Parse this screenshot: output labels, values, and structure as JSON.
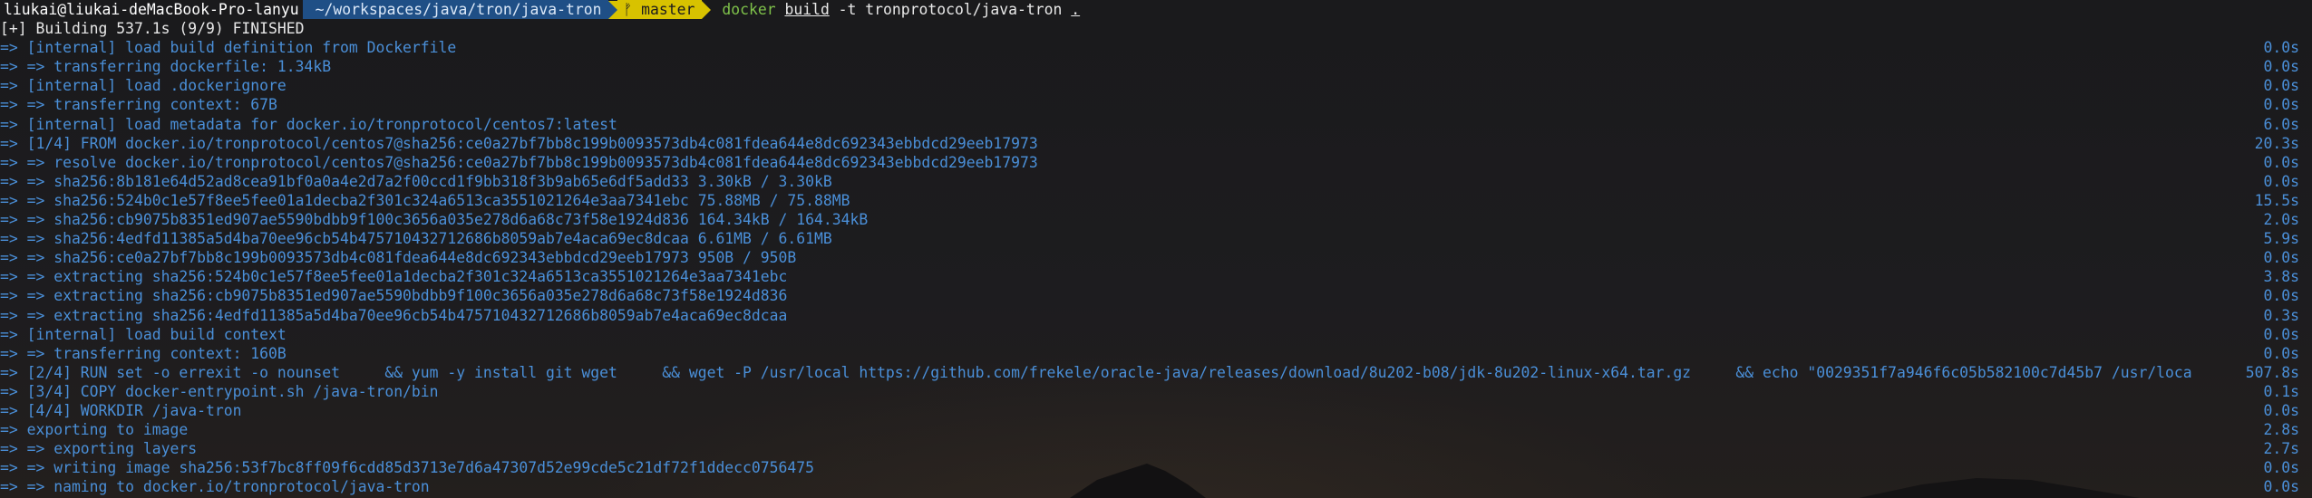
{
  "prompt": {
    "user_host": "liukai@liukai-deMacBook-Pro-lanyu",
    "path": "~/workspaces/java/tron/java-tron",
    "git_symbol": "ᚠ",
    "branch": "master",
    "cmd_docker": "docker",
    "cmd_build": "build",
    "cmd_args": " -t tronprotocol/java-tron ",
    "cmd_dot": "."
  },
  "header": "[+] Building 537.1s (9/9) FINISHED",
  "lines": [
    {
      "text": "=> [internal] load build definition from Dockerfile",
      "time": "0.0s"
    },
    {
      "text": "=> => transferring dockerfile: 1.34kB",
      "time": "0.0s"
    },
    {
      "text": "=> [internal] load .dockerignore",
      "time": "0.0s"
    },
    {
      "text": "=> => transferring context: 67B",
      "time": "0.0s"
    },
    {
      "text": "=> [internal] load metadata for docker.io/tronprotocol/centos7:latest",
      "time": "6.0s"
    },
    {
      "text": "=> [1/4] FROM docker.io/tronprotocol/centos7@sha256:ce0a27bf7bb8c199b0093573db4c081fdea644e8dc692343ebbdcd29eeb17973",
      "time": "20.3s"
    },
    {
      "text": "=> => resolve docker.io/tronprotocol/centos7@sha256:ce0a27bf7bb8c199b0093573db4c081fdea644e8dc692343ebbdcd29eeb17973",
      "time": "0.0s"
    },
    {
      "text": "=> => sha256:8b181e64d52ad8cea91bf0a0a4e2d7a2f00ccd1f9bb318f3b9ab65e6df5add33 3.30kB / 3.30kB",
      "time": "0.0s"
    },
    {
      "text": "=> => sha256:524b0c1e57f8ee5fee01a1decba2f301c324a6513ca3551021264e3aa7341ebc 75.88MB / 75.88MB",
      "time": "15.5s"
    },
    {
      "text": "=> => sha256:cb9075b8351ed907ae5590bdbb9f100c3656a035e278d6a68c73f58e1924d836 164.34kB / 164.34kB",
      "time": "2.0s"
    },
    {
      "text": "=> => sha256:4edfd11385a5d4ba70ee96cb54b475710432712686b8059ab7e4aca69ec8dcaa 6.61MB / 6.61MB",
      "time": "5.9s"
    },
    {
      "text": "=> => sha256:ce0a27bf7bb8c199b0093573db4c081fdea644e8dc692343ebbdcd29eeb17973 950B / 950B",
      "time": "0.0s"
    },
    {
      "text": "=> => extracting sha256:524b0c1e57f8ee5fee01a1decba2f301c324a6513ca3551021264e3aa7341ebc",
      "time": "3.8s"
    },
    {
      "text": "=> => extracting sha256:cb9075b8351ed907ae5590bdbb9f100c3656a035e278d6a68c73f58e1924d836",
      "time": "0.0s"
    },
    {
      "text": "=> => extracting sha256:4edfd11385a5d4ba70ee96cb54b475710432712686b8059ab7e4aca69ec8dcaa",
      "time": "0.3s"
    },
    {
      "text": "=> [internal] load build context",
      "time": "0.0s"
    },
    {
      "text": "=> => transferring context: 160B",
      "time": "0.0s"
    },
    {
      "text": "=> [2/4] RUN set -o errexit -o nounset     && yum -y install git wget     && wget -P /usr/local https://github.com/frekele/oracle-java/releases/download/8u202-b08/jdk-8u202-linux-x64.tar.gz     && echo \"0029351f7a946f6c05b582100c7d45b7 /usr/loca",
      "time": "507.8s"
    },
    {
      "text": "=> [3/4] COPY docker-entrypoint.sh /java-tron/bin",
      "time": "0.1s"
    },
    {
      "text": "=> [4/4] WORKDIR /java-tron",
      "time": "0.0s"
    },
    {
      "text": "=> exporting to image",
      "time": "2.8s"
    },
    {
      "text": "=> => exporting layers",
      "time": "2.7s"
    },
    {
      "text": "=> => writing image sha256:53f7bc8ff09f6cdd85d3713e7d6a47307d52e99cde5c21df72f1ddecc0756475",
      "time": "0.0s"
    },
    {
      "text": "=> => naming to docker.io/tronprotocol/java-tron",
      "time": "0.0s"
    }
  ]
}
